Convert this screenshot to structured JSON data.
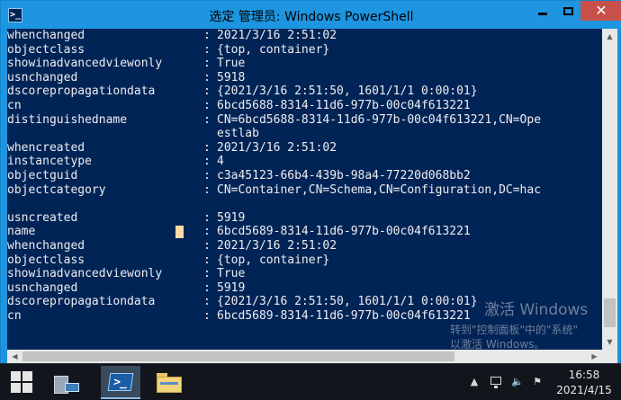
{
  "window": {
    "title": "选定 管理员: Windows PowerShell",
    "icon_name": "powershell-icon"
  },
  "console": {
    "lines": [
      {
        "k": "whenchanged",
        "c": ":",
        "v": "2021/3/16 2:51:02"
      },
      {
        "k": "objectclass",
        "c": ":",
        "v": "{top, container}"
      },
      {
        "k": "showinadvancedviewonly",
        "c": ":",
        "v": "True"
      },
      {
        "k": "usnchanged",
        "c": ":",
        "v": "5918"
      },
      {
        "k": "dscorepropagationdata",
        "c": ":",
        "v": "{2021/3/16 2:51:50, 1601/1/1 0:00:01}"
      },
      {
        "k": "cn",
        "c": ":",
        "v": "6bcd5688-8314-11d6-977b-00c04f613221"
      },
      {
        "k": "distinguishedname",
        "c": ":",
        "v": "CN=6bcd5688-8314-11d6-977b-00c04f613221,CN=Ope"
      },
      {
        "k": "",
        "c": "",
        "v": "estlab"
      },
      {
        "k": "whencreated",
        "c": ":",
        "v": "2021/3/16 2:51:02"
      },
      {
        "k": "instancetype",
        "c": ":",
        "v": "4"
      },
      {
        "k": "objectguid",
        "c": ":",
        "v": "c3a45123-66b4-439b-98a4-77220d068bb2"
      },
      {
        "k": "objectcategory",
        "c": ":",
        "v": "CN=Container,CN=Schema,CN=Configuration,DC=hac"
      },
      {
        "k": "",
        "c": "",
        "v": ""
      },
      {
        "k": "usncreated",
        "c": ":",
        "v": "5919"
      },
      {
        "k": "name",
        "c": ":",
        "v": "6bcd5689-8314-11d6-977b-00c04f613221"
      },
      {
        "k": "whenchanged",
        "c": ":",
        "v": "2021/3/16 2:51:02"
      },
      {
        "k": "objectclass",
        "c": ":",
        "v": "{top, container}"
      },
      {
        "k": "showinadvancedviewonly",
        "c": ":",
        "v": "True"
      },
      {
        "k": "usnchanged",
        "c": ":",
        "v": "5919"
      },
      {
        "k": "dscorepropagationdata",
        "c": ":",
        "v": "{2021/3/16 2:51:50, 1601/1/1 0:00:01}"
      },
      {
        "k": "cn",
        "c": ":",
        "v": "6bcd5689-8314-11d6-977b-00c04f613221"
      }
    ],
    "colors": {
      "background": "#012456",
      "foreground": "#eeedf0",
      "cursor": "#fedba9"
    }
  },
  "watermark": {
    "line1": "激活 Windows",
    "line2": "转到\"控制面板\"中的\"系统\"",
    "line3": "以激活 Windows。"
  },
  "taskbar": {
    "buttons": [
      {
        "name": "server-manager",
        "icon": "server-manager-icon"
      },
      {
        "name": "powershell",
        "icon": "powershell-icon",
        "active": true
      },
      {
        "name": "file-explorer",
        "icon": "folder-icon"
      }
    ],
    "tray": {
      "up_arrow": "▲",
      "volume": "🔈",
      "flag": "⚑"
    },
    "clock": {
      "time": "16:58",
      "date": "2021/4/15"
    }
  }
}
